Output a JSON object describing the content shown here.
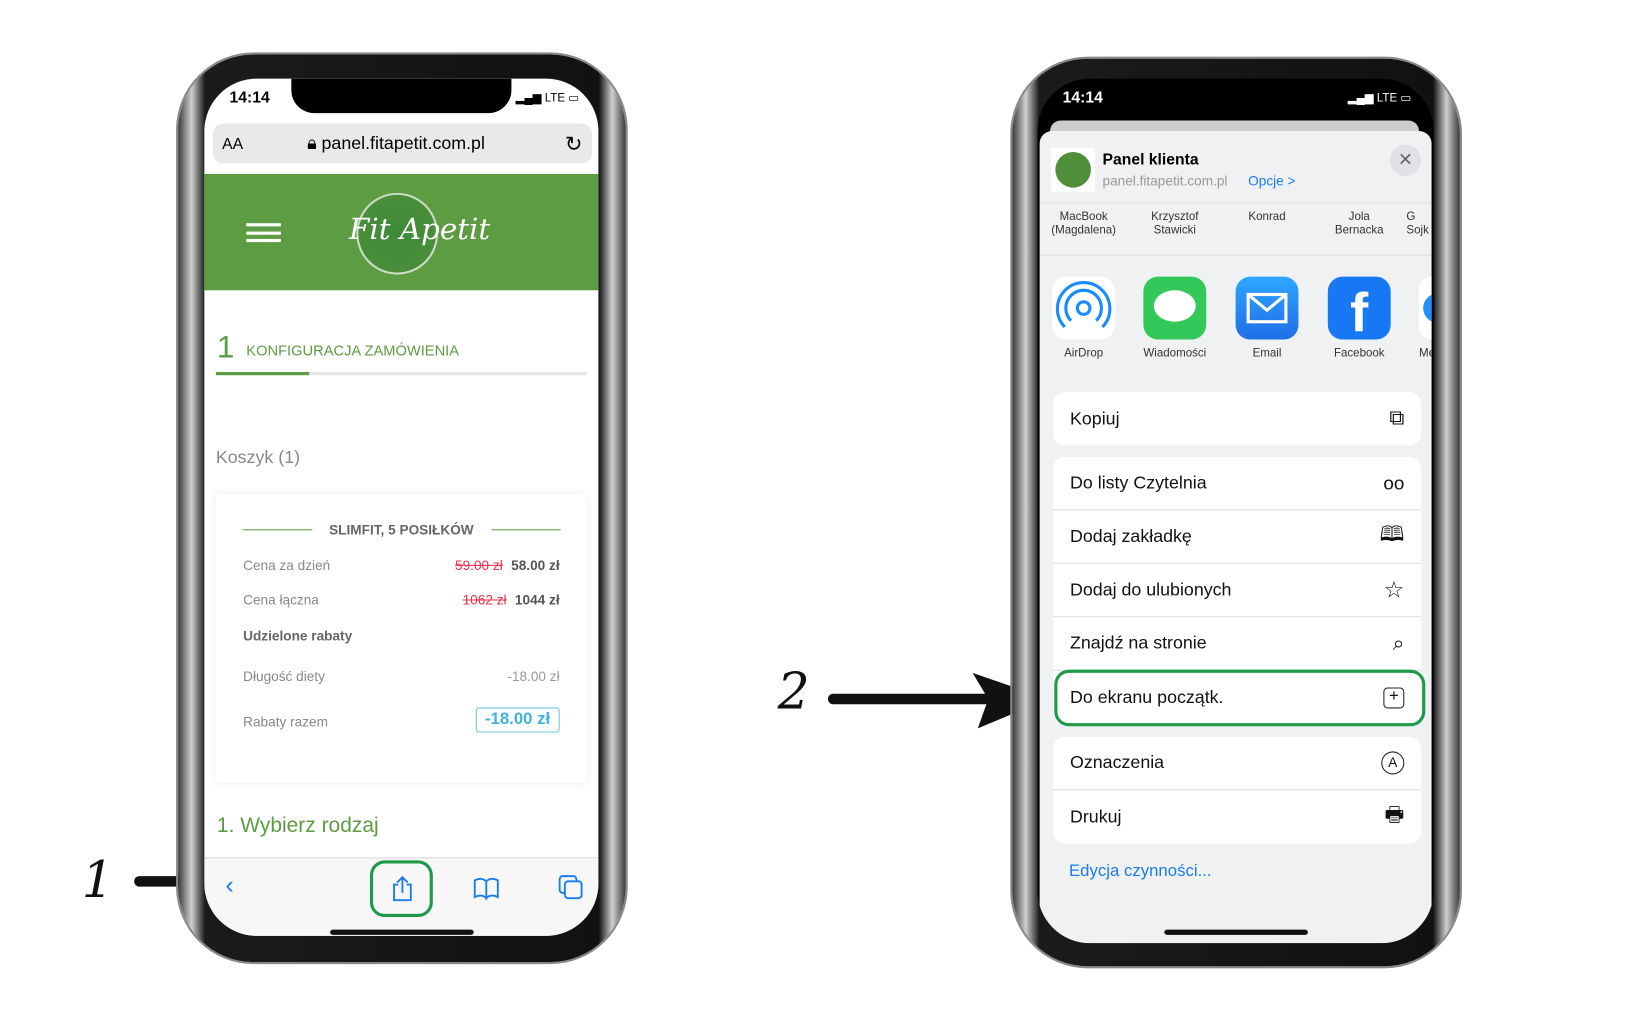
{
  "annotations": {
    "step1": "1",
    "step2": "2"
  },
  "left_phone": {
    "status": {
      "time": "14:14",
      "network": "LTE"
    },
    "url_bar": {
      "text_size": "AA",
      "url": "panel.fitapetit.com.pl"
    },
    "logo": "Fit Apetit",
    "step": {
      "number": "1",
      "label": "KONFIGURACJA ZAMÓWIENIA",
      "progress_fraction": 0.25
    },
    "cart_title": "Koszyk (1)",
    "card": {
      "title": "SLIMFIT, 5 POSIŁKÓW",
      "rows": [
        {
          "label": "Cena za dzień",
          "old": "59.00 zł",
          "new": "58.00 zł"
        },
        {
          "label": "Cena łączna",
          "old": "1062 zł",
          "new": "1044 zł"
        }
      ],
      "discounts_title": "Udzielone rabaty",
      "discount_label": "Długość diety",
      "discount_value": "-18.00 zł",
      "total_label": "Rabaty razem",
      "total_value": "-18.00 zł"
    },
    "section_title": "1. Wybierz rodzaj",
    "toolbar": [
      "back-icon",
      "share-icon",
      "bookmarks-icon",
      "tabs-icon"
    ]
  },
  "right_phone": {
    "status": {
      "time": "14:14",
      "network": "LTE"
    },
    "sheet": {
      "title": "Panel klienta",
      "subtitle": "panel.fitapetit.com.pl",
      "options": "Opcje >",
      "people": [
        "MacBook\n(Magdalena)",
        "Krzysztof\nStawicki",
        "Konrad",
        "Jola\nBernacka",
        "G\nSojk"
      ],
      "apps": [
        {
          "label": "AirDrop",
          "color": "#1a8cff"
        },
        {
          "label": "Wiadomości",
          "color": "#34c759"
        },
        {
          "label": "Email",
          "color": "#1e7cf2"
        },
        {
          "label": "Facebook",
          "color": "#1877f2"
        },
        {
          "label": "Me",
          "color": "#1e90ff"
        }
      ],
      "group1": [
        {
          "label": "Kopiuj",
          "icon": "copy-icon"
        }
      ],
      "group2": [
        {
          "label": "Do listy Czytelnia",
          "icon": "glasses-icon"
        },
        {
          "label": "Dodaj zakładkę",
          "icon": "book-icon"
        },
        {
          "label": "Dodaj do ulubionych",
          "icon": "star-icon"
        },
        {
          "label": "Znajdź na stronie",
          "icon": "search-icon"
        },
        {
          "label": "Do ekranu początk.",
          "icon": "plus-square-icon"
        }
      ],
      "group3": [
        {
          "label": "Oznaczenia",
          "icon": "markup-icon"
        },
        {
          "label": "Drukuj",
          "icon": "printer-icon"
        }
      ],
      "edit_actions": "Edycja czynności...",
      "highlight_color": "#1e9a4a"
    }
  }
}
